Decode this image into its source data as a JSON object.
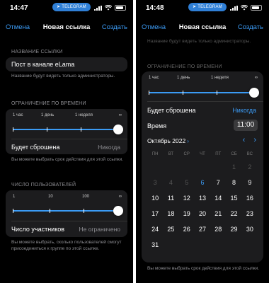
{
  "left": {
    "status": {
      "time": "14:47",
      "app_pill": "TELEGRAM"
    },
    "nav": {
      "cancel": "Отмена",
      "title": "Новая ссылка",
      "create": "Создать"
    },
    "link_name": {
      "section": "НАЗВАНИЕ ССЫЛКИ",
      "value": "Пост в канале eLama",
      "note": "Название будут видеть только администраторы."
    },
    "time_limit": {
      "section": "ОГРАНИЧЕНИЕ ПО ВРЕМЕНИ",
      "labels": [
        "1 час",
        "1 день",
        "1 неделя",
        "∞"
      ],
      "reset_label": "Будет сброшена",
      "reset_value": "Никогда",
      "note": "Вы можете выбрать срок действия для этой ссылки."
    },
    "user_limit": {
      "section": "ЧИСЛО ПОЛЬЗОВАТЕЛЕЙ",
      "labels": [
        "1",
        "10",
        "100",
        "∞"
      ],
      "count_label": "Число участников",
      "count_value": "Не ограничено",
      "note": "Вы можете выбрать, сколько пользователей смогут присоединиться к группе по этой ссылке."
    }
  },
  "right": {
    "status": {
      "time": "14:48",
      "app_pill": "TELEGRAM"
    },
    "nav": {
      "cancel": "Отмена",
      "title": "Новая ссылка",
      "create": "Создать"
    },
    "bg_note": "Название будут видеть только администраторы.",
    "section": "ОГРАНИЧЕНИЕ ПО ВРЕМЕНИ",
    "labels": [
      "1 час",
      "1 день",
      "1 неделя",
      "∞"
    ],
    "reset_label": "Будет сброшена",
    "reset_value": "Никогда",
    "time_label": "Время",
    "time_value": "11:00",
    "month": "Октябрь 2022",
    "weekdays": [
      "ПН",
      "ВТ",
      "СР",
      "ЧТ",
      "ПТ",
      "СБ",
      "ВС"
    ],
    "days": [
      "",
      "",
      "",
      "",
      "",
      "1",
      "2",
      "3",
      "4",
      "5",
      "6",
      "7",
      "8",
      "9",
      "10",
      "11",
      "12",
      "13",
      "14",
      "15",
      "16",
      "17",
      "18",
      "19",
      "20",
      "21",
      "22",
      "23",
      "24",
      "25",
      "26",
      "27",
      "28",
      "29",
      "30",
      "31"
    ],
    "today": "6",
    "past_until": "5",
    "note": "Вы можете выбрать срок действия для этой ссылки."
  },
  "colors": {
    "accent": "#3b9bf5",
    "card": "#1c1c1e",
    "muted": "#8e8e93"
  }
}
